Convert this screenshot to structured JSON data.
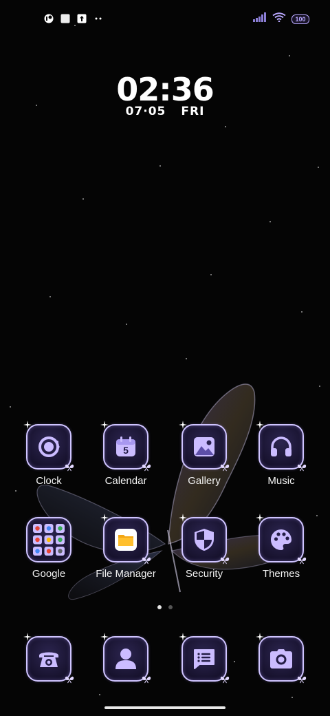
{
  "status_bar": {
    "left_icons": [
      "notification-app-icon",
      "notification-square-icon",
      "upload-icon",
      "more-notifications-icon"
    ],
    "right_icons": [
      "signal-icon",
      "wifi-icon",
      "battery-icon"
    ],
    "battery_level": "100"
  },
  "clock_widget": {
    "time": "02:36",
    "date": "07·05",
    "weekday": "FRI"
  },
  "apps": {
    "clock": {
      "label": "Clock"
    },
    "calendar": {
      "label": "Calendar",
      "day": "5"
    },
    "gallery": {
      "label": "Gallery"
    },
    "music": {
      "label": "Music"
    },
    "google": {
      "label": "Google"
    },
    "file_manager": {
      "label": "File Manager"
    },
    "security": {
      "label": "Security"
    },
    "themes": {
      "label": "Themes"
    }
  },
  "dock": {
    "items": [
      "Phone",
      "Contacts",
      "Messages",
      "Camera"
    ]
  },
  "page_indicator": {
    "pages": 2,
    "current": 1
  },
  "colors": {
    "accent": "#b9a8ff",
    "icon_fill": "#cbbcff",
    "background": "#050505"
  }
}
